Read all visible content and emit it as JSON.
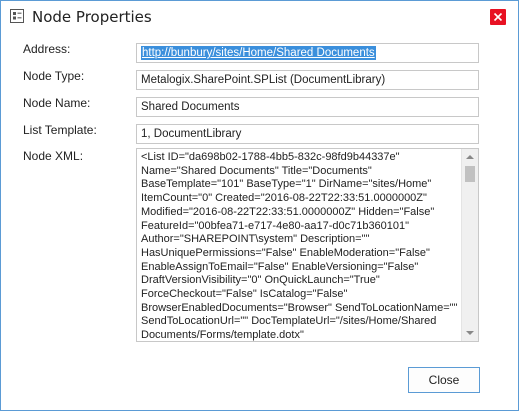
{
  "window": {
    "title": "Node Properties"
  },
  "fields": {
    "address": {
      "label": "Address:",
      "value": "http://bunbury/sites/Home/Shared Documents"
    },
    "node_type": {
      "label": "Node Type:",
      "value": "Metalogix.SharePoint.SPList (DocumentLibrary)"
    },
    "node_name": {
      "label": "Node Name:",
      "value": "Shared Documents"
    },
    "list_template": {
      "label": "List Template:",
      "value": "1, DocumentLibrary"
    },
    "node_xml": {
      "label": "Node XML:",
      "value": "<List ID=\"da698b02-1788-4bb5-832c-98fd9b44337e\"\nName=\"Shared Documents\" Title=\"Documents\"\nBaseTemplate=\"101\" BaseType=\"1\" DirName=\"sites/Home\"\nItemCount=\"0\" Created=\"2016-08-22T22:33:51.0000000Z\"\nModified=\"2016-08-22T22:33:51.0000000Z\" Hidden=\"False\"\nFeatureId=\"00bfea71-e717-4e80-aa17-d0c71b360101\"\nAuthor=\"SHAREPOINT\\system\" Description=\"\"\nHasUniquePermissions=\"False\" EnableModeration=\"False\"\nEnableAssignToEmail=\"False\" EnableVersioning=\"False\"\nDraftVersionVisibility=\"0\" OnQuickLaunch=\"True\"\nForceCheckout=\"False\" IsCatalog=\"False\"\nBrowserEnabledDocuments=\"Browser\" SendToLocationName=\"\"\nSendToLocationUrl=\"\" DocTemplateUrl=\"/sites/Home/Shared\nDocuments/Forms/template.dotx\""
    }
  },
  "buttons": {
    "close_label": "Close"
  },
  "colors": {
    "accent": "#5b9bd5",
    "selection": "#3b8fdc",
    "close_x": "#e81123"
  },
  "icons": {
    "title": "node-properties-icon",
    "close": "close-icon"
  }
}
